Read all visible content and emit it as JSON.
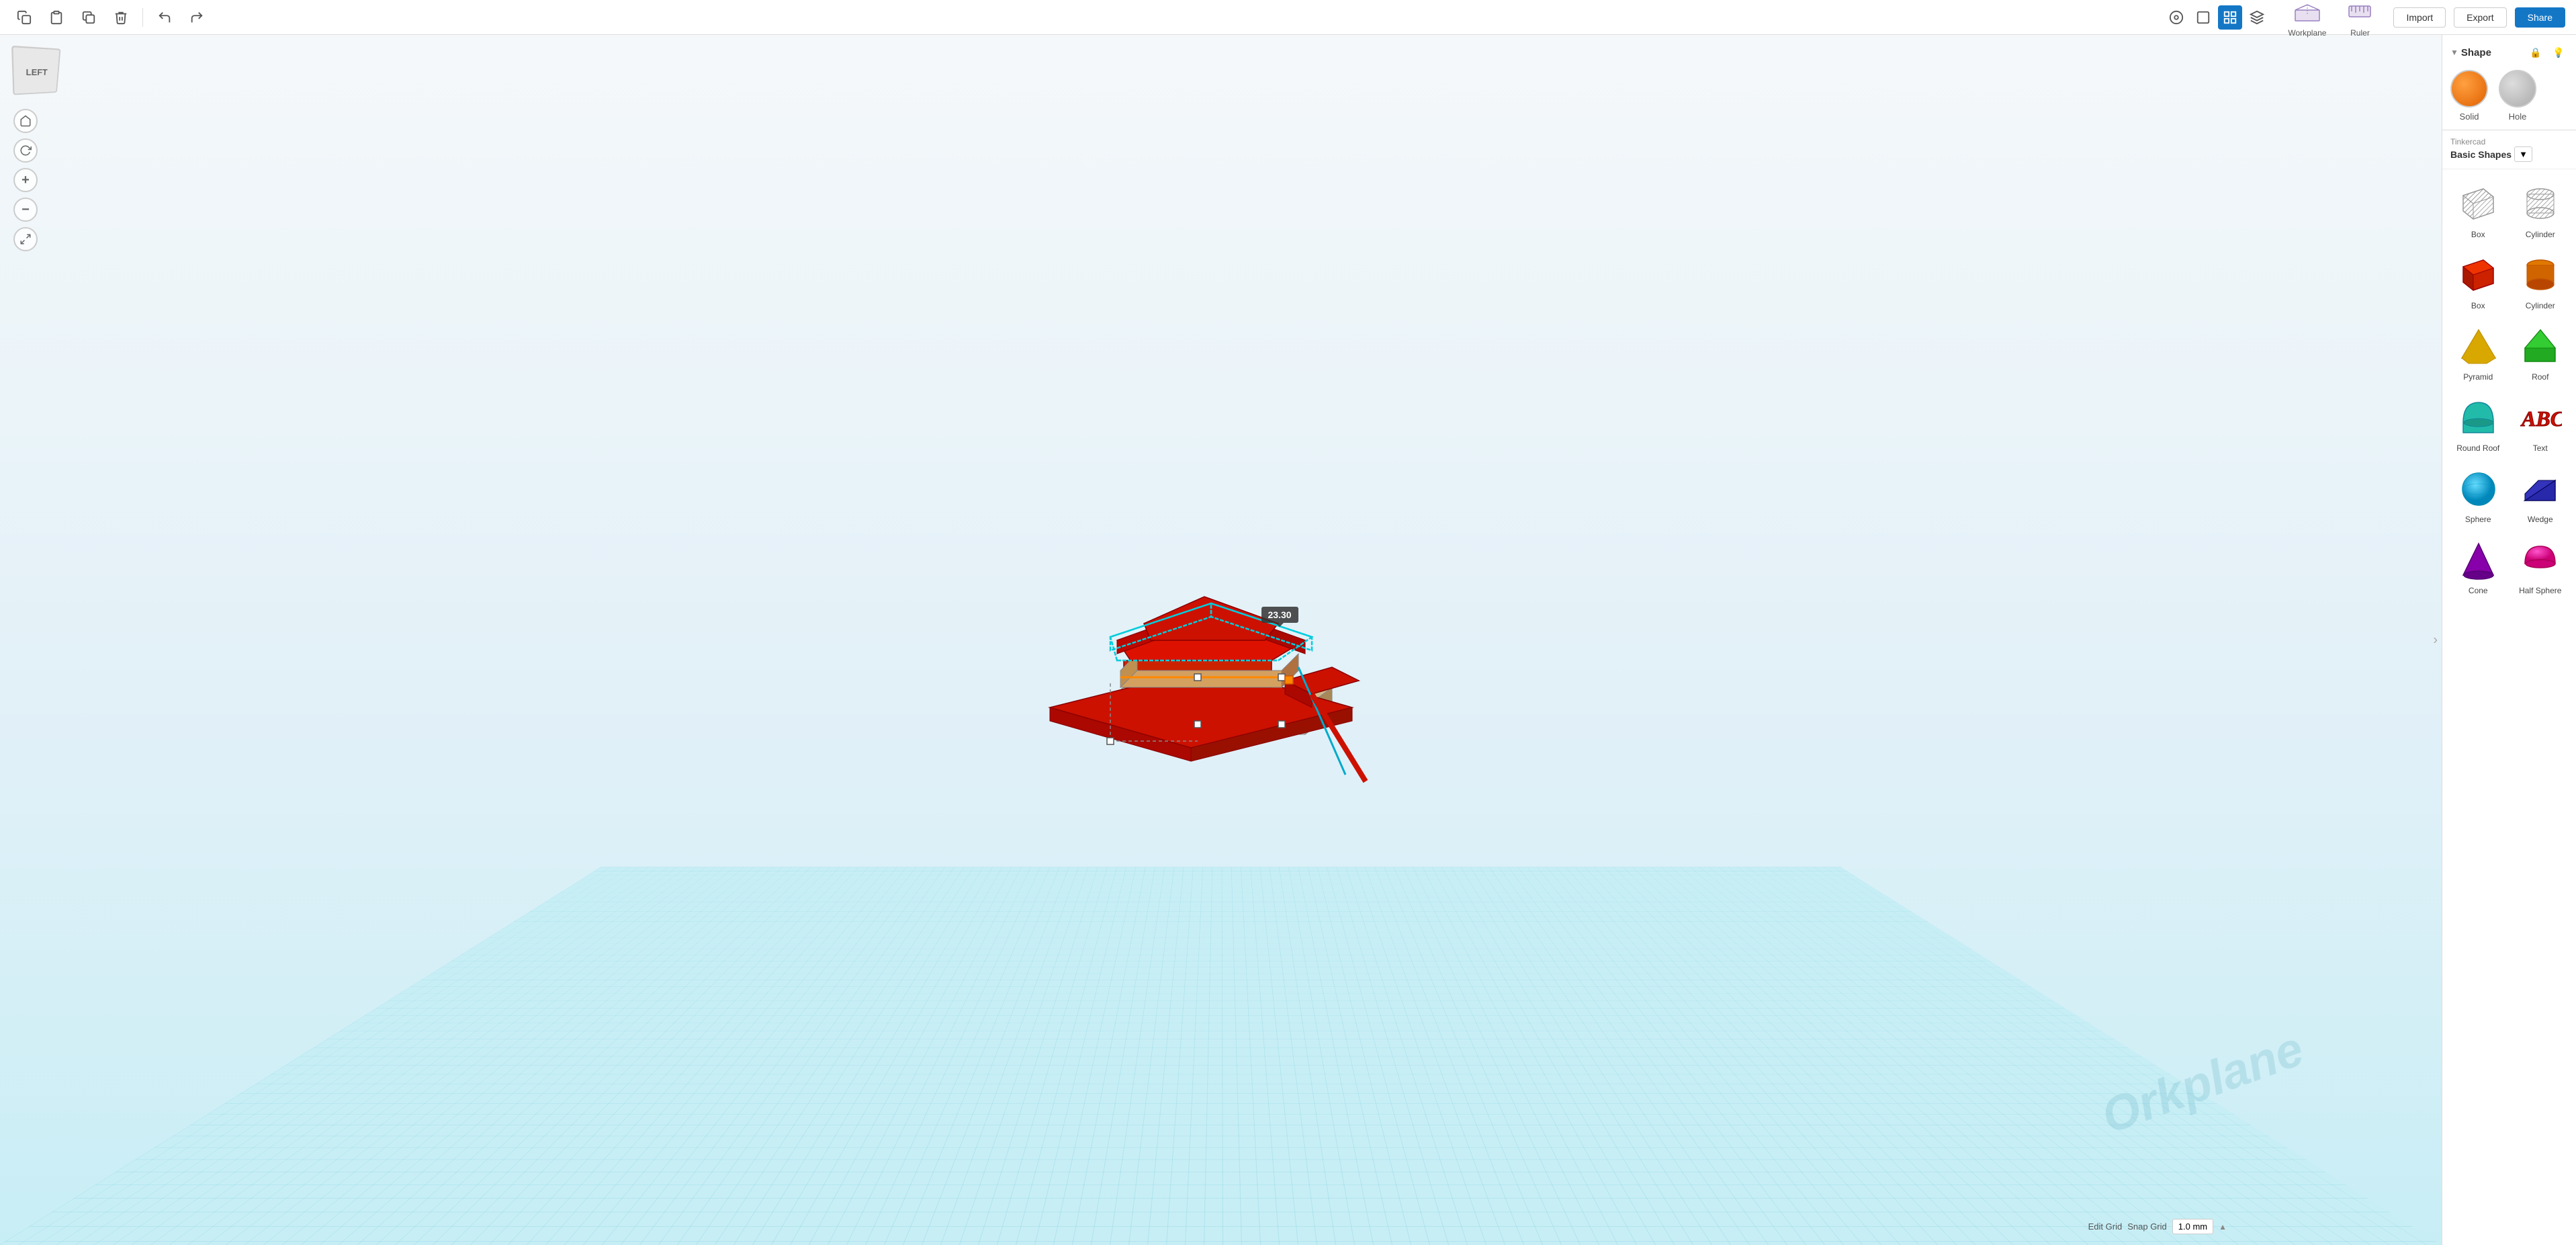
{
  "toolbar": {
    "copy_label": "Copy",
    "paste_label": "Paste",
    "duplicate_label": "Duplicate",
    "delete_label": "Delete",
    "undo_label": "Undo",
    "redo_label": "Redo",
    "import_label": "Import",
    "export_label": "Export",
    "share_label": "Share"
  },
  "view_cube": {
    "label": "LEFT"
  },
  "shape_panel": {
    "title": "Shape",
    "solid_label": "Solid",
    "hole_label": "Hole"
  },
  "library": {
    "source": "Tinkercad",
    "name": "Basic Shapes",
    "dropdown_arrow": "▼"
  },
  "shapes": [
    {
      "id": "box-gray",
      "label": "Box",
      "color": "#bbb",
      "type": "box-striped"
    },
    {
      "id": "cylinder-gray",
      "label": "Cylinder",
      "color": "#bbb",
      "type": "cylinder-striped"
    },
    {
      "id": "box-red",
      "label": "Box",
      "color": "#cc2200",
      "type": "box-solid"
    },
    {
      "id": "cylinder-orange",
      "label": "Cylinder",
      "color": "#e07000",
      "type": "cylinder-solid"
    },
    {
      "id": "pyramid",
      "label": "Pyramid",
      "color": "#f0c000",
      "type": "pyramid"
    },
    {
      "id": "roof",
      "label": "Roof",
      "color": "#22aa22",
      "type": "roof"
    },
    {
      "id": "round-roof",
      "label": "Round Roof",
      "color": "#22bbaa",
      "type": "round-roof"
    },
    {
      "id": "text",
      "label": "Text",
      "color": "#cc2200",
      "type": "text-3d"
    },
    {
      "id": "sphere",
      "label": "Sphere",
      "color": "#00aacc",
      "type": "sphere"
    },
    {
      "id": "wedge",
      "label": "Wedge",
      "color": "#1a1a88",
      "type": "wedge"
    },
    {
      "id": "cone",
      "label": "Cone",
      "color": "#8800aa",
      "type": "cone"
    },
    {
      "id": "half-sphere",
      "label": "Half Sphere",
      "color": "#cc0088",
      "type": "half-sphere"
    }
  ],
  "measurement": {
    "value": "23.30"
  },
  "workplane_label": "Workplane",
  "ruler_label": "Ruler",
  "bottom": {
    "edit_grid": "Edit Grid",
    "snap_grid": "Snap Grid",
    "snap_value": "1.0 mm"
  },
  "watermark": "Orkplane"
}
